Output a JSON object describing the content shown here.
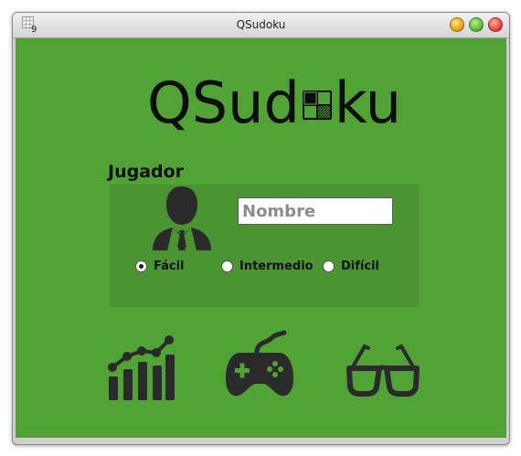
{
  "window": {
    "title": "QSudoku",
    "app_icon_digit": "9",
    "controls": [
      "minimize-icon",
      "maximize-icon",
      "close-icon"
    ]
  },
  "logo": {
    "text_before": "QSud",
    "text_after": "ku",
    "o_replacement_icon": "sudoku-grid-icon"
  },
  "player": {
    "section_label": "Jugador",
    "avatar_icon": "businessman-avatar-icon",
    "name_input": {
      "value": "",
      "placeholder": "Nombre"
    }
  },
  "difficulty": {
    "options": [
      "Fácil",
      "Intermedio",
      "Difícil"
    ],
    "selected": "Fácil"
  },
  "actions": [
    {
      "icon": "statistics-chart-icon"
    },
    {
      "icon": "gamepad-icon"
    },
    {
      "icon": "glasses-icon"
    }
  ],
  "colors": {
    "background": "#51a336",
    "panel": "#4a9531",
    "icons": "#2a2a2a"
  }
}
